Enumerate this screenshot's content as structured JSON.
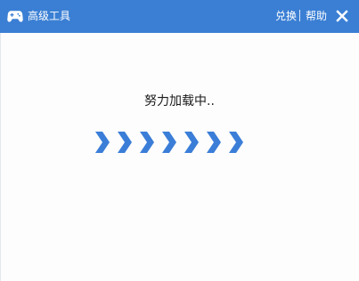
{
  "window": {
    "title": "高级工具",
    "app_icon": "gamepad-icon",
    "links": {
      "switch_label": "兑换",
      "help_label": "帮助"
    },
    "close_icon": "close-icon"
  },
  "loading": {
    "text": "努力加载中..",
    "indicator_icon": "chevron-right-icon"
  },
  "colors": {
    "titlebar": "#3a7fd4",
    "accent": "#3b7ed8",
    "background": "#fdfdfd"
  }
}
